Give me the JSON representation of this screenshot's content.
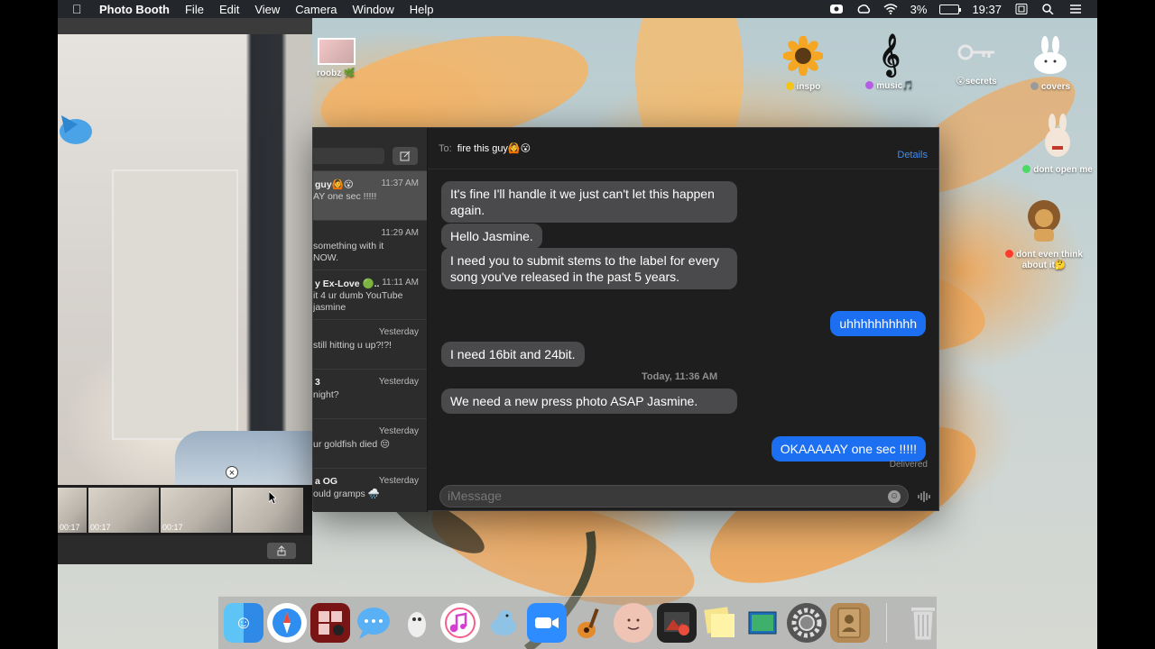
{
  "menubar": {
    "app_name": "Photo Booth",
    "items": [
      "File",
      "Edit",
      "View",
      "Camera",
      "Window",
      "Help"
    ],
    "battery": "3%",
    "time": "19:37",
    "icons": [
      "apple-icon",
      "screen-record-icon",
      "creative-cloud-icon",
      "wifi-icon",
      "battery-icon",
      "notification-center-icon",
      "spotlight-icon",
      "control-strip-icon"
    ]
  },
  "photobooth": {
    "thumbnails": [
      {
        "duration": "00:17"
      },
      {
        "duration": "00:17"
      },
      {
        "duration": "00:17"
      },
      {
        "duration": ""
      }
    ]
  },
  "desktop_icons": [
    {
      "label": "roobz 🌿",
      "icon": "photo-icon"
    },
    {
      "label": "inspo",
      "icon": "sunflower-icon",
      "dot": "#f5c518"
    },
    {
      "label": "music🎵",
      "icon": "treble-clef-icon",
      "dot": "#b65ee6"
    },
    {
      "label": "😮secrets",
      "icon": "key-icon"
    },
    {
      "label": "covers",
      "icon": "bunny-icon",
      "dot": "#9a9a9a"
    },
    {
      "label": "dont open me",
      "icon": "bunny-icon",
      "dot": "#4cd964"
    },
    {
      "label": "dont even think about it🤔",
      "icon": "lion-icon",
      "dot": "#ff3b30"
    }
  ],
  "messages": {
    "conversations": [
      {
        "name": "guy🙆😮",
        "time": "11:37 AM",
        "preview": "AY one sec !!!!!"
      },
      {
        "name": "",
        "time": "11:29 AM",
        "preview": "something with it\nNOW."
      },
      {
        "name": "y Ex-Love 🟢..",
        "time": "11:11 AM",
        "preview": "it 4 ur dumb YouTube\njasmine"
      },
      {
        "name": "",
        "time": "Yesterday",
        "preview": "still hitting u up?!?!"
      },
      {
        "name": "3",
        "time": "Yesterday",
        "preview": "night?"
      },
      {
        "name": "",
        "time": "Yesterday",
        "preview": "ur goldfish died 😔"
      },
      {
        "name": "a OG",
        "time": "Yesterday",
        "preview": "ould gramps 🌧️"
      }
    ],
    "to_label": "To:",
    "to_name": "fire this guy🙆😮",
    "details_label": "Details",
    "bubbles": [
      {
        "text": "It's fine I'll handle it we just can't let this happen again.",
        "from": "them"
      },
      {
        "text": "Hello Jasmine.",
        "from": "them"
      },
      {
        "text": "I need you to submit stems to the label for every song you've released in the past 5 years.",
        "from": "them"
      },
      {
        "text": "uhhhhhhhhhh",
        "from": "me"
      },
      {
        "text": "I need 16bit and 24bit.",
        "from": "them"
      },
      {
        "text": "We need a new press photo ASAP Jasmine.",
        "from": "them"
      },
      {
        "text": "OKAAAAAY one sec !!!!!",
        "from": "me"
      }
    ],
    "timestamp": "Today, 11:36 AM",
    "delivered": "Delivered",
    "input_placeholder": "iMessage"
  },
  "dock": {
    "apps": [
      "Finder",
      "Safari",
      "Photo Booth",
      "Messages",
      "Inkscape",
      "iTunes",
      "Sequel",
      "Zoom",
      "GarageBand",
      "Face",
      "Photo Slideshow",
      "Stickies",
      "Preview",
      "System Preferences",
      "Contacts"
    ],
    "trash": "Trash"
  }
}
